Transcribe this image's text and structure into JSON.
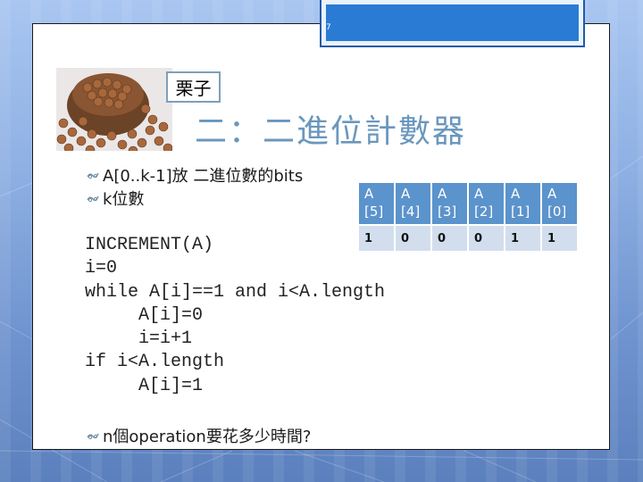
{
  "slide": {
    "number": "7",
    "image_caption": "栗子",
    "title": "二：二進位計數器",
    "bullets": [
      {
        "icon": "vine-bullet-icon",
        "text": "A[0..k-1]放 二進位數的bits"
      },
      {
        "icon": "vine-bullet-icon",
        "text": "k位數"
      }
    ],
    "bit_table": {
      "headers": [
        "A[5]",
        "A[4]",
        "A[3]",
        "A[2]",
        "A[1]",
        "A[0]"
      ],
      "values": [
        "1",
        "0",
        "0",
        "0",
        "1",
        "1"
      ]
    },
    "code_lines": [
      "INCREMENT(A)",
      "i=0",
      "while A[i]==1 and i<A.length",
      "     A[i]=0",
      "     i=i+1",
      "if i<A.length",
      "     A[i]=1"
    ],
    "question_bullet": {
      "icon": "vine-bullet-icon",
      "text": "n個operation要花多少時間?"
    }
  },
  "colors": {
    "title": "#6a97bd",
    "table_header": "#5b93cc",
    "table_cell": "#d2deee",
    "slide_number_box": "#2a7bd4"
  }
}
